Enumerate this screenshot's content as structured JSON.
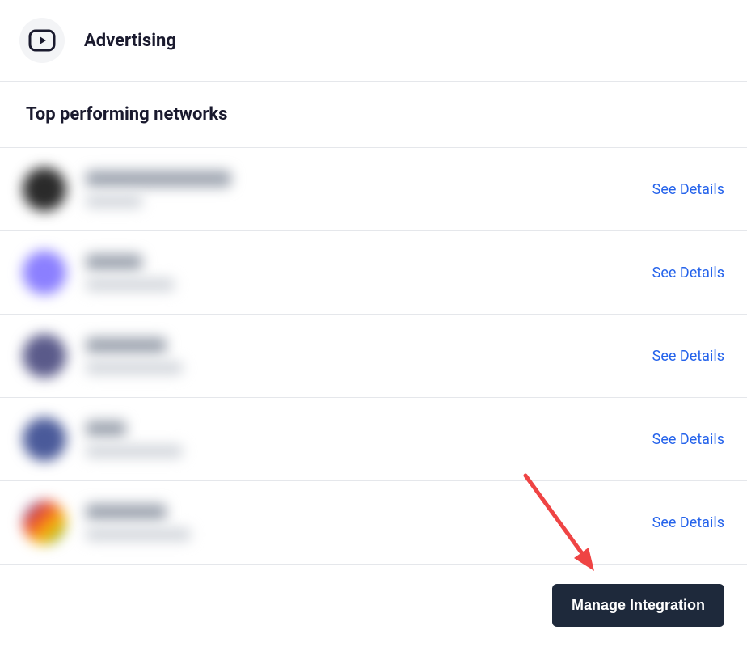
{
  "header": {
    "title": "Advertising"
  },
  "section": {
    "title": "Top performing networks"
  },
  "networks": [
    {
      "see_details": "See Details"
    },
    {
      "see_details": "See Details"
    },
    {
      "see_details": "See Details"
    },
    {
      "see_details": "See Details"
    },
    {
      "see_details": "See Details"
    }
  ],
  "footer": {
    "manage_button": "Manage Integration"
  }
}
